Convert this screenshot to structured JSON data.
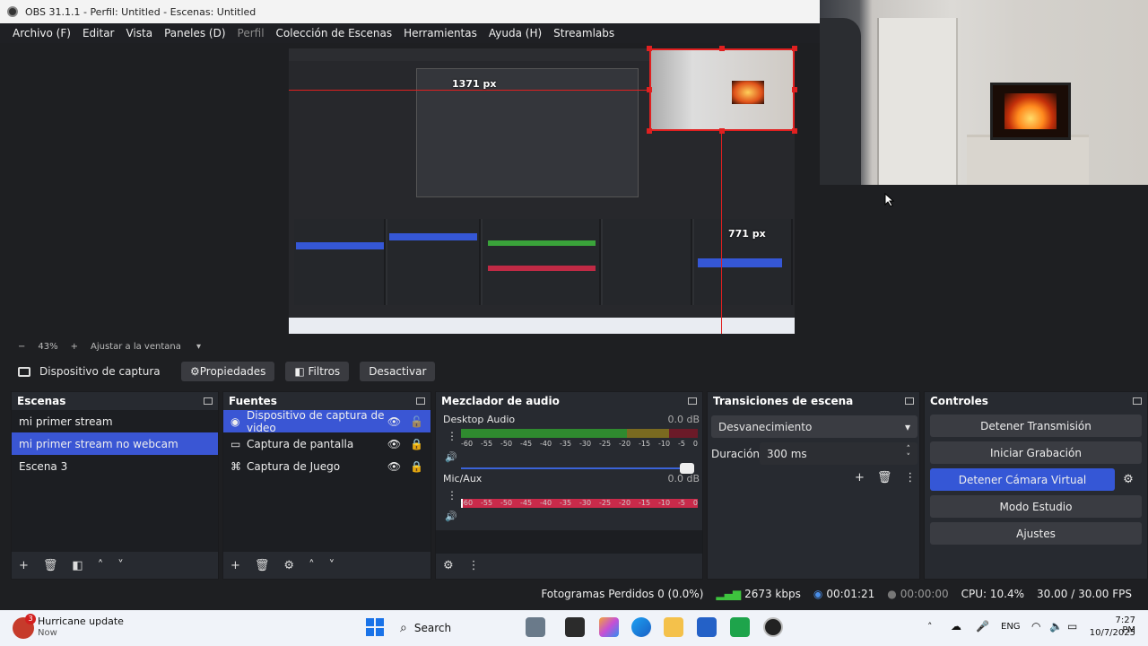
{
  "window": {
    "title": "OBS 31.1.1 - Perfil: Untitled - Escenas: Untitled"
  },
  "menu": [
    "Archivo (F)",
    "Editar",
    "Vista",
    "Paneles (D)",
    "Perfil",
    "Colección de Escenas",
    "Herramientas",
    "Ayuda (H)",
    "Streamlabs"
  ],
  "preview": {
    "label_top": "1371 px",
    "label_right": "771 px"
  },
  "zoom": {
    "minus": "−",
    "value": "43%",
    "plus": "+",
    "fit": "Ajustar a la ventana"
  },
  "source_toolbar": {
    "source": "Dispositivo de captura de v",
    "properties": "Propiedades",
    "filters": "Filtros",
    "deactivate": "Desactivar"
  },
  "scenes": {
    "title": "Escenas",
    "items": [
      "mi primer stream",
      "mi primer stream no webcam",
      "Escena 3"
    ],
    "active_index": 1
  },
  "sources": {
    "title": "Fuentes",
    "items": [
      {
        "name": "Dispositivo de captura de video",
        "icon": "camera-icon"
      },
      {
        "name": "Captura de pantalla",
        "icon": "monitor-icon"
      },
      {
        "name": "Captura de Juego",
        "icon": "gamepad-icon"
      }
    ]
  },
  "mixer": {
    "title": "Mezclador de audio",
    "channels": [
      {
        "name": "Desktop Audio",
        "db": "0.0 dB"
      },
      {
        "name": "Mic/Aux",
        "db": "0.0 dB"
      }
    ],
    "ticks": [
      "-60",
      "-55",
      "-50",
      "-45",
      "-40",
      "-35",
      "-30",
      "-25",
      "-20",
      "-15",
      "-10",
      "-5",
      "0"
    ]
  },
  "transitions": {
    "title": "Transiciones de escena",
    "type": "Desvanecimiento",
    "duration_label": "Duración",
    "duration_value": "300 ms"
  },
  "controls": {
    "title": "Controles",
    "buttons": [
      "Detener Transmisión",
      "Iniciar Grabación",
      "Detener Cámara Virtual",
      "Modo Estudio",
      "Ajustes"
    ]
  },
  "status": {
    "dropped": "Fotogramas Perdidos 0 (0.0%)",
    "bitrate": "2673 kbps",
    "stream_time": "00:01:21",
    "rec_time": "00:00:00",
    "cpu": "CPU: 10.4%",
    "fps": "30.00 / 30.00 FPS"
  },
  "taskbar": {
    "notification_title": "Hurricane update",
    "notification_sub": "Now",
    "badge": "3",
    "search": "Search",
    "lang": "ENG",
    "time": "7:27 PM",
    "date": "10/7/2025"
  },
  "colors": {
    "accent": "#3557d6",
    "selection": "#e02020",
    "meter_red": "#c92a4a"
  }
}
